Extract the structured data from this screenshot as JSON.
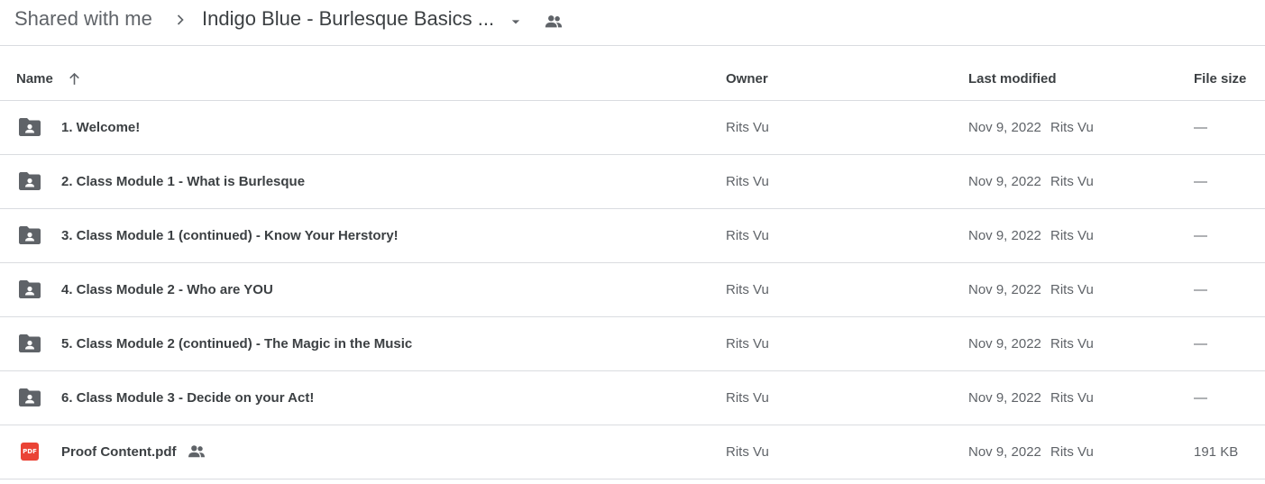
{
  "breadcrumb": {
    "root": "Shared with me",
    "current": "Indigo Blue - Burlesque Basics ..."
  },
  "columns": {
    "name": "Name",
    "owner": "Owner",
    "last_modified": "Last modified",
    "file_size": "File size"
  },
  "rows": [
    {
      "type": "shared-folder",
      "name": "1. Welcome!",
      "owner": "Rits Vu",
      "modified_date": "Nov 9, 2022",
      "modified_by": "Rits Vu",
      "size": "—"
    },
    {
      "type": "shared-folder",
      "name": "2. Class Module 1 - What is Burlesque",
      "owner": "Rits Vu",
      "modified_date": "Nov 9, 2022",
      "modified_by": "Rits Vu",
      "size": "—"
    },
    {
      "type": "shared-folder",
      "name": "3. Class Module 1 (continued) - Know Your Herstory!",
      "owner": "Rits Vu",
      "modified_date": "Nov 9, 2022",
      "modified_by": "Rits Vu",
      "size": "—"
    },
    {
      "type": "shared-folder",
      "name": "4. Class Module 2 - Who are YOU",
      "owner": "Rits Vu",
      "modified_date": "Nov 9, 2022",
      "modified_by": "Rits Vu",
      "size": "—"
    },
    {
      "type": "shared-folder",
      "name": "5. Class Module 2 (continued) - The Magic in the Music",
      "owner": "Rits Vu",
      "modified_date": "Nov 9, 2022",
      "modified_by": "Rits Vu",
      "size": "—"
    },
    {
      "type": "shared-folder",
      "name": "6. Class Module 3 - Decide on your Act!",
      "owner": "Rits Vu",
      "modified_date": "Nov 9, 2022",
      "modified_by": "Rits Vu",
      "size": "—"
    },
    {
      "type": "pdf",
      "icon_label": "PDF",
      "name": "Proof Content.pdf",
      "owner": "Rits Vu",
      "modified_date": "Nov 9, 2022",
      "modified_by": "Rits Vu",
      "size": "191 KB",
      "shared": true
    }
  ],
  "icons": {
    "breadcrumb_separator": "chevron-right-icon",
    "breadcrumb_dropdown": "arrow-drop-down-icon",
    "breadcrumb_shared": "people-icon",
    "sort": "arrow-up-icon",
    "folder": "shared-folder-icon",
    "pdf": "pdf-file-icon"
  },
  "colors": {
    "text_primary": "#3c4043",
    "text_secondary": "#5f6368",
    "divider": "#dadce0",
    "pdf_red": "#ea4335"
  }
}
